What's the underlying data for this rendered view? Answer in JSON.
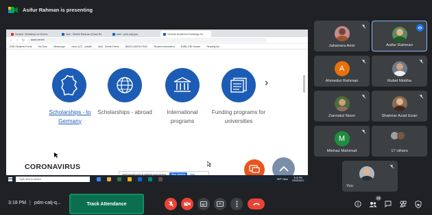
{
  "presenter_banner": {
    "text": "Asifur Rahman is presenting"
  },
  "browser": {
    "tabs": [
      {
        "label": "Scratch: Workshop on Germa",
        "color": "#d93025",
        "active": false
      },
      {
        "label": "Mail - Sheikh Rahman (Exam Re",
        "color": "#0a66c2",
        "active": false
      },
      {
        "label": "Mail - pdm-catj-qua",
        "color": "#0a66c2",
        "active": false
      },
      {
        "label": "German Academic Exchange Se",
        "color": "#1d5cb5",
        "active": true
      }
    ],
    "url": "daad.de/en/",
    "bookmarks": [
      "DUB Students Portal",
      "YouTube",
      "Messenger",
      "Inbox (47) - arafath",
      "Mail - Sheikh Rahm",
      "BANGLADESH RAG",
      "Student Information",
      "EMBL-EBI Human",
      "Reading list"
    ]
  },
  "page": {
    "categories": [
      {
        "label": "Scholarships - to Germany",
        "link": true,
        "icon": "germany-map-icon"
      },
      {
        "label": "Scholarships - abroad",
        "link": false,
        "icon": "globe-icon"
      },
      {
        "label": "International programs",
        "link": false,
        "icon": "university-building-icon"
      },
      {
        "label": "Funding programs for universities",
        "link": false,
        "icon": "document-icon"
      }
    ],
    "section_heading": "CORONAVIRUS",
    "sharing_notice": "meet.google.com is sharing your screen.",
    "stop_sharing": "Stop sharing",
    "hide": "Hide",
    "taskbar_search": "Type here to search",
    "taskbar_weather": "68°F Haze",
    "taskbar_time": "3:18 PM",
    "taskbar_date": "10/23/2021"
  },
  "participants": [
    {
      "name": "Jahanara Amir",
      "kind": "photo",
      "bg": "#c98b8b",
      "muted": true,
      "active": false
    },
    {
      "name": "Asifur Rahman",
      "kind": "photo",
      "bg": "#5d8a5a",
      "muted": false,
      "active": true
    },
    {
      "name": "Ahmedur Rahman",
      "kind": "letter",
      "letter": "A",
      "bg": "#e8710a",
      "muted": true,
      "active": false
    },
    {
      "name": "Rubel Mridha",
      "kind": "photo",
      "bg": "#6b7b8c",
      "muted": true,
      "active": false
    },
    {
      "name": "Zannatul Noori",
      "kind": "photo",
      "bg": "#4f6b3a",
      "muted": true,
      "active": false
    },
    {
      "name": "Shahriar Azad Evan",
      "kind": "photo",
      "bg": "#8a6b4f",
      "muted": true,
      "active": false
    },
    {
      "name": "Minhaz Mahmud",
      "kind": "letter",
      "letter": "M",
      "bg": "#1e8e3e",
      "muted": true,
      "active": false
    },
    {
      "name": "17 others",
      "kind": "others",
      "muted": false,
      "active": false
    },
    {
      "name": "You",
      "kind": "photo",
      "bg": "#b0b7c0",
      "muted": true,
      "active": false
    }
  ],
  "bottom": {
    "time": "3:18 PM",
    "separator": "|",
    "meeting_code": "pdm-catj-q...",
    "track_attendance": "Track Attendance",
    "people_count": "24"
  },
  "colors": {
    "meet_background": "#202124",
    "tile_background": "#3c4043",
    "danger_red": "#ea4335",
    "daad_blue": "#1d5cb5",
    "attendance_green": "#0b6e4f"
  }
}
